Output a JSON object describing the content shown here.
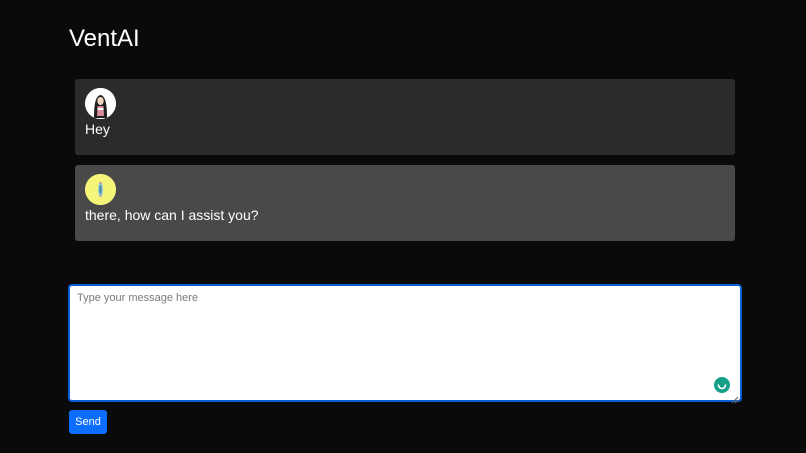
{
  "app": {
    "title": "VentAI"
  },
  "messages": [
    {
      "role": "user",
      "avatar_icon": "user-avatar-icon",
      "text": "Hey"
    },
    {
      "role": "assistant",
      "avatar_icon": "bot-avatar-icon",
      "text": "there, how can I assist you?"
    }
  ],
  "composer": {
    "placeholder": "Type your message here",
    "value": ""
  },
  "actions": {
    "send_label": "Send"
  },
  "colors": {
    "background": "#0a0a0a",
    "user_message_bg": "#292b2c",
    "assistant_message_bg": "#494949",
    "accent": "#0d6efd",
    "bot_avatar_bg": "#f5f57a"
  }
}
